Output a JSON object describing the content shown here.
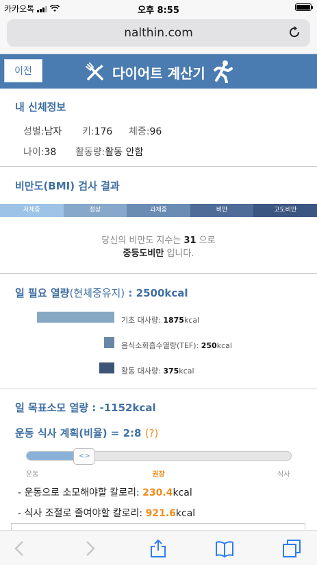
{
  "status_bar": {
    "carrier": "카카오톡",
    "time": "오후 8:55"
  },
  "browser": {
    "url": "nalthin.com"
  },
  "header": {
    "back_label": "이전",
    "title": "다이어트 계산기"
  },
  "body_info": {
    "title": "내 신체정보",
    "gender_label": "성별:",
    "gender_value": "남자",
    "height_label": "키:",
    "height_value": "176",
    "weight_label": "체중:",
    "weight_value": "96",
    "age_label": "나이:",
    "age_value": "38",
    "activity_label": "활동량:",
    "activity_value": "활동 안함"
  },
  "bmi": {
    "title": "비만도(BMI) 검사 결과",
    "levels": [
      "저체중",
      "정상",
      "과체중",
      "비만",
      "고도비만"
    ],
    "level_colors": [
      "#9dc3e6",
      "#87a8c8",
      "#6a8cb3",
      "#4e6c97",
      "#3b5680"
    ],
    "result_prefix": "당신의 비만도 지수는",
    "index": "31",
    "result_suffix": "으로",
    "category": "중등도비만",
    "category_suffix": "입니다."
  },
  "daily_energy": {
    "title_main": "일 필요 열량",
    "title_sub": "(현체중유지)",
    "title_value": ": 2500kcal",
    "items": [
      {
        "label": "기초 대사량:",
        "value": "1875",
        "unit": "kcal",
        "color": "#87a8c2"
      },
      {
        "label": "음식소화흡수열량(TEF):",
        "value": "250",
        "unit": "kcal",
        "color": "#6a87a8"
      },
      {
        "label": "활동 대사량:",
        "value": "375",
        "unit": "kcal",
        "color": "#3b5478"
      }
    ]
  },
  "target": {
    "title": "일 목표소모 열량 : -1152kcal",
    "plan_title": "운동 식사 계획(비율) = 2:8",
    "plan_help": "(?)",
    "slider": {
      "handle_label": "<>",
      "fill_fraction": 0.22,
      "left_label": "운동",
      "center_label": "권장",
      "right_label": "식사",
      "center_color": "#f08c1e"
    },
    "exercise_prefix": "- 운동으로 소모해야할 칼로리:",
    "exercise_value": "230.4",
    "exercise_unit": "kcal",
    "diet_prefix": "- 식사 조절로 줄여야할 칼로리:",
    "diet_value": "921.6",
    "diet_unit": "kcal"
  },
  "toolbar": {
    "icons": [
      "back-arrow-icon",
      "forward-arrow-icon",
      "share-icon",
      "bookmarks-icon",
      "tabs-icon"
    ]
  }
}
